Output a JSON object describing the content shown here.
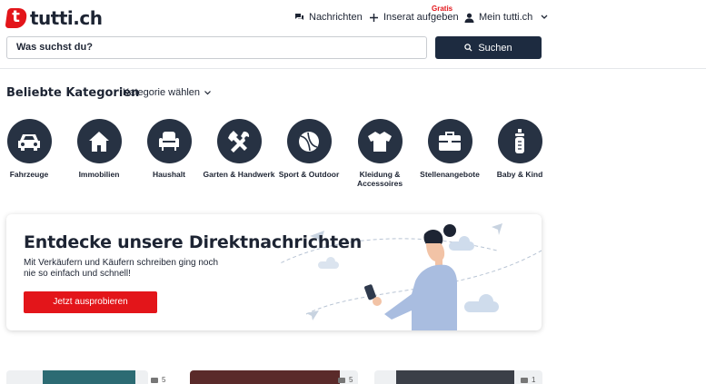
{
  "header": {
    "logo_text": "tutti.ch",
    "nav": {
      "messages": "Nachrichten",
      "post_ad": "Inserat aufgeben",
      "post_ad_badge": "Gratis",
      "account": "Mein tutti.ch"
    }
  },
  "search": {
    "placeholder": "Was suchst du?",
    "button": "Suchen"
  },
  "categories": {
    "title": "Beliebte Kategorien",
    "select_label": "Kategorie wählen",
    "items": [
      {
        "label": "Fahrzeuge",
        "icon": "car-icon"
      },
      {
        "label": "Immobilien",
        "icon": "house-icon"
      },
      {
        "label": "Haushalt",
        "icon": "armchair-icon"
      },
      {
        "label": "Garten & Handwerk",
        "icon": "tools-icon"
      },
      {
        "label": "Sport & Outdoor",
        "icon": "ball-icon"
      },
      {
        "label": "Kleidung & Accessoires",
        "icon": "shirt-icon"
      },
      {
        "label": "Stellenangebote",
        "icon": "briefcase-icon"
      },
      {
        "label": "Baby & Kind",
        "icon": "baby-bottle-icon"
      }
    ]
  },
  "promo": {
    "title": "Entdecke unsere Direktnachrichten",
    "text": "Mit Verkäufern und Käufern schreiben ging noch nie so einfach und schnell!",
    "button": "Jetzt ausprobieren"
  },
  "listings": [
    {
      "photo_count": "5"
    },
    {
      "photo_count": "5"
    },
    {
      "photo_count": "1"
    }
  ],
  "colors": {
    "brand_red": "#e3151a",
    "dark_navy": "#1d2b40",
    "icon_circle": "#273243"
  }
}
